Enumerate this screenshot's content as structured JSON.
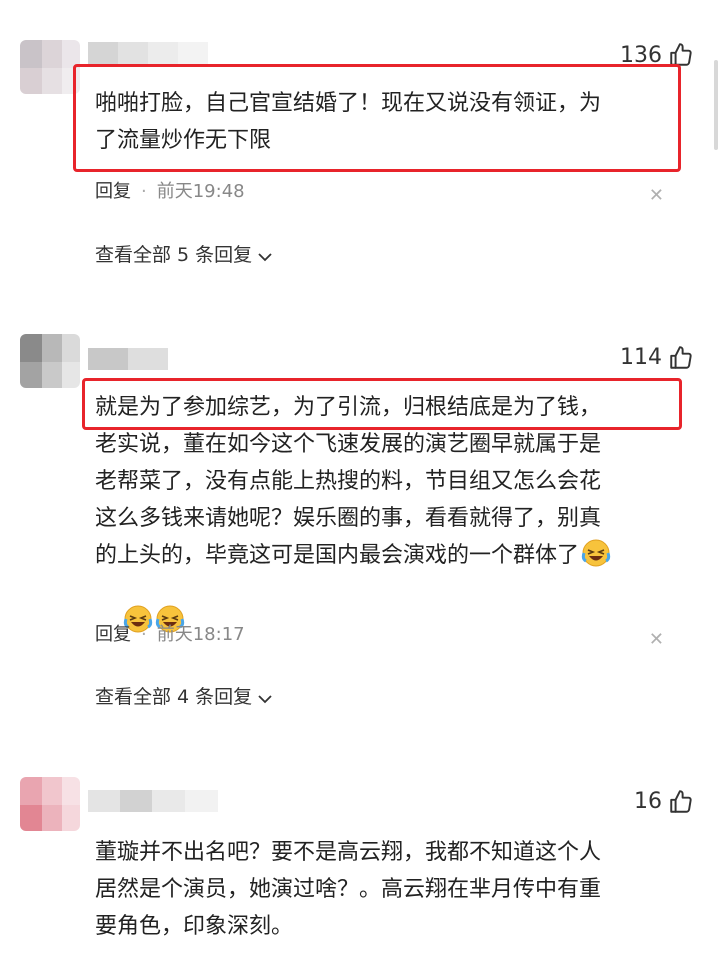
{
  "comments": [
    {
      "likes": "136",
      "text": "啪啪打脸，自己官宣结婚了！现在又说没有领证，为\n了流量炒作无下限",
      "reply_label": "回复",
      "separator": "·",
      "time": "前天19:48",
      "view_all": "查看全部 5 条回复",
      "emoji_count": 0
    },
    {
      "likes": "114",
      "text": "就是为了参加综艺，为了引流，归根结底是为了钱，\n老实说，董在如今这个飞速发展的演艺圈早就属于是\n老帮菜了，没有点能上热搜的料，节目组又怎么会花\n这么多钱来请她呢？娱乐圈的事，看看就得了，别真\n的上头的，毕竟这可是国内最会演戏的一个群体了",
      "reply_label": "回复",
      "separator": "·",
      "time": "前天18:17",
      "view_all": "查看全部 4 条回复",
      "emoji_count": 3
    },
    {
      "likes": "16",
      "text": "董璇并不出名吧？要不是高云翔，我都不知道这个人\n居然是个演员，她演过啥？。高云翔在芈月传中有重\n要角色，印象深刻。",
      "emoji_count": 0
    }
  ],
  "icons": {
    "like": "thumbs-up-icon",
    "close": "close-icon",
    "chevron": "chevron-down-icon",
    "emoji": "laughing-crying-emoji-icon"
  },
  "colors": {
    "highlight": "#e8242b",
    "meta": "#888888",
    "text": "#222222"
  }
}
